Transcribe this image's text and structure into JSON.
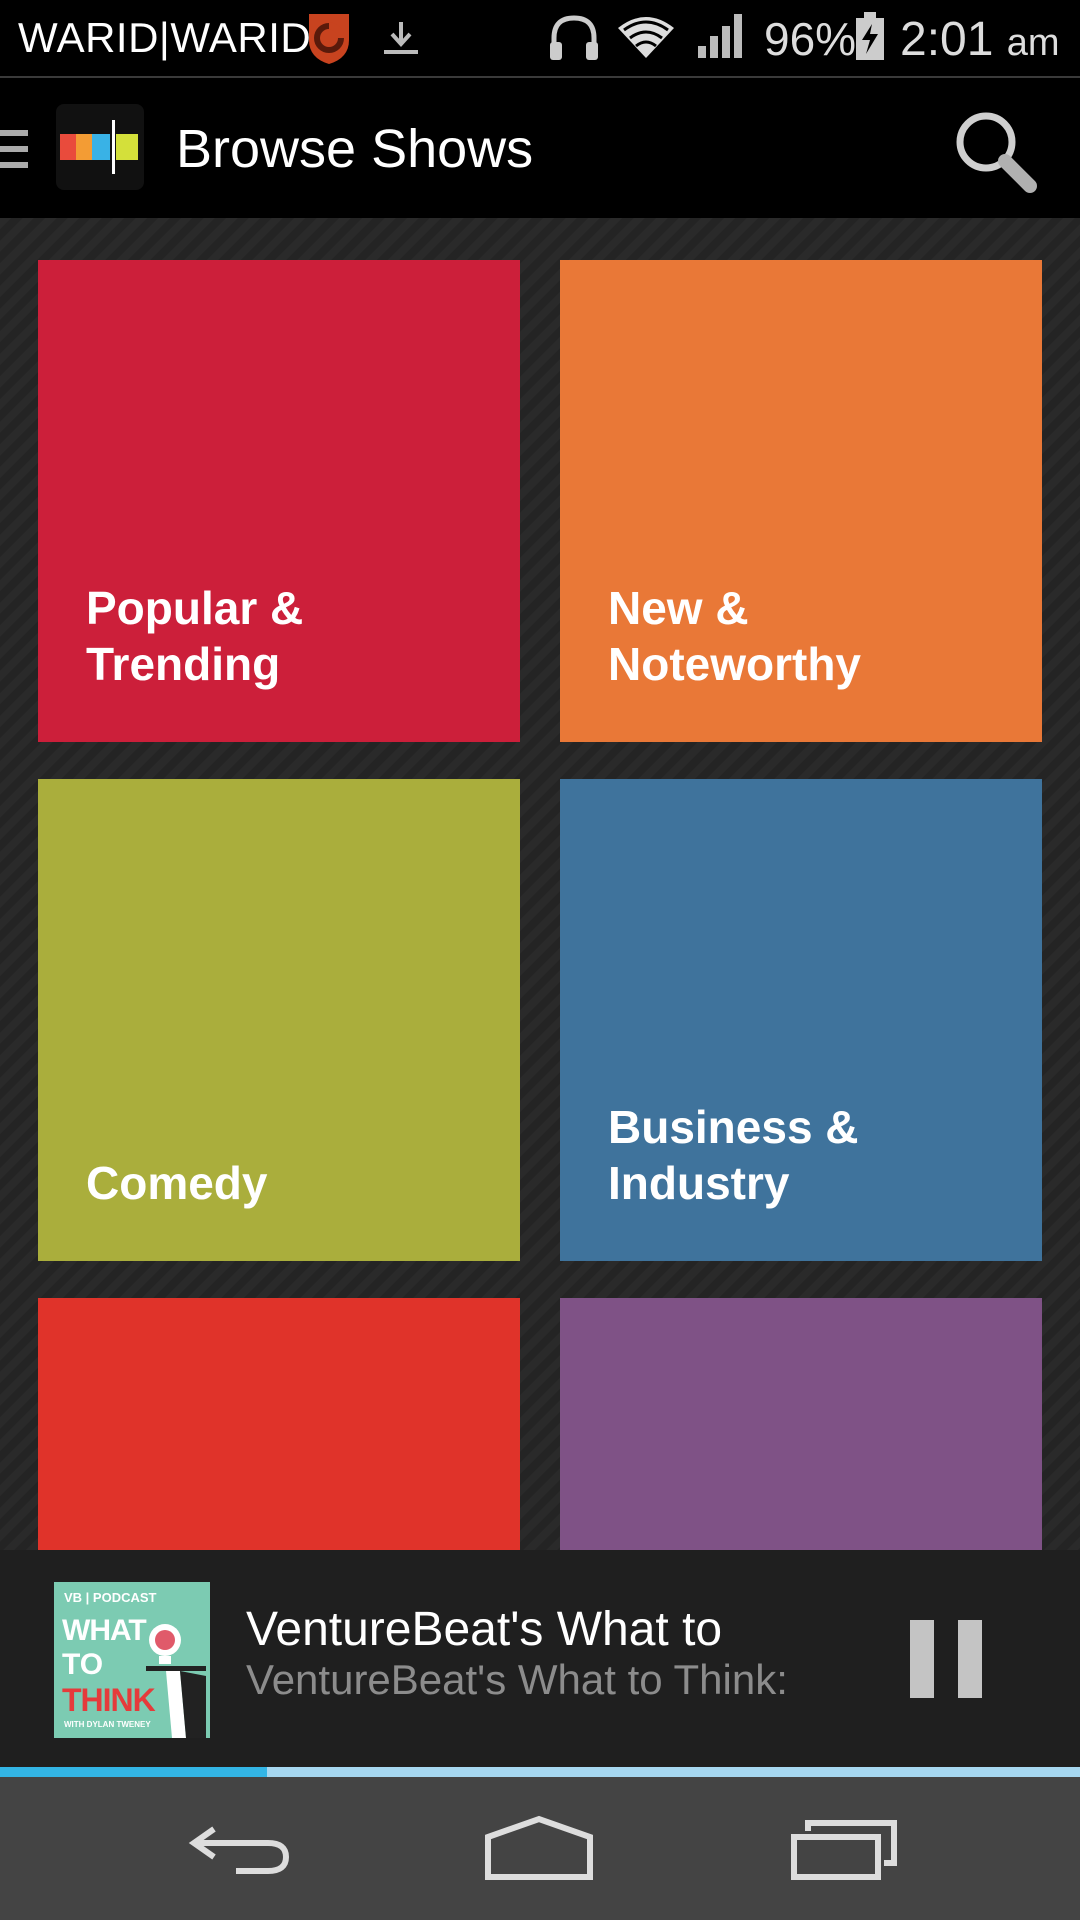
{
  "status_bar": {
    "carrier": "WARID|WARID",
    "battery_percent": "96%",
    "time": "2:01",
    "time_suffix": "am",
    "icons": [
      "shield-icon",
      "download-icon",
      "headphones-icon",
      "wifi-icon",
      "signal-icon",
      "battery-charging-icon"
    ]
  },
  "action_bar": {
    "title": "Browse Shows",
    "drawer_icon": "drawer-menu-icon",
    "logo_icon": "app-logo-icon",
    "search_icon": "search-icon"
  },
  "categories": [
    {
      "label": "Popular &\nTrending",
      "color": "#cc1f3a"
    },
    {
      "label": "New &\nNoteworthy",
      "color": "#e97837"
    },
    {
      "label": "Comedy",
      "color": "#aaae3c"
    },
    {
      "label": "Business &\nIndustry",
      "color": "#3f739c"
    },
    {
      "label": "",
      "color": "#e0332a"
    },
    {
      "label": "",
      "color": "#7f5286"
    }
  ],
  "now_playing": {
    "title": "VentureBeat's What to",
    "subtitle": "VentureBeat's What to Think:",
    "progress": 0.247,
    "art": {
      "brand": "VB | PODCAST",
      "line1": "WHAT",
      "line2": "TO",
      "line3": "THINK",
      "byline": "WITH DYLAN TWENEY"
    },
    "pause_icon": "pause-icon"
  },
  "nav_bar": {
    "icons": [
      "back-icon",
      "home-icon",
      "recent-apps-icon"
    ]
  },
  "colors": {
    "status_bar_bg": "#000000",
    "action_bar_bg": "#000000",
    "grid_bg": "#262626",
    "now_playing_bg": "#1f1f1f",
    "progress_fill": "#33b5e5",
    "progress_track": "#a6d7f0",
    "nav_bar_bg": "#444444"
  }
}
